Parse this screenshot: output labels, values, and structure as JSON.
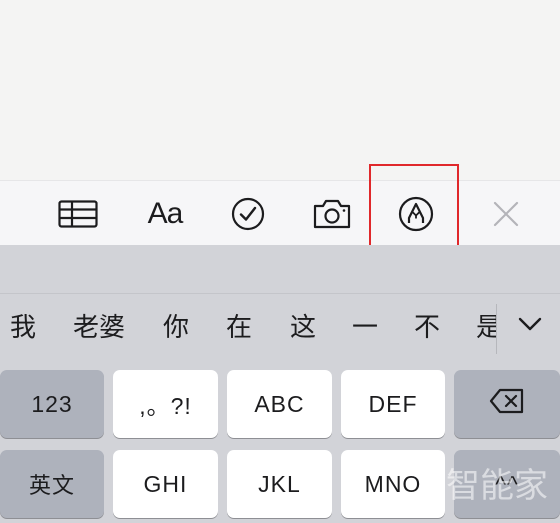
{
  "toolbar": {
    "items": [
      {
        "name": "table",
        "icon": "table-icon"
      },
      {
        "name": "format",
        "label": "Aa",
        "icon": "text-format-icon"
      },
      {
        "name": "checklist",
        "icon": "checkmark-circle-icon"
      },
      {
        "name": "camera",
        "icon": "camera-icon"
      },
      {
        "name": "markup",
        "icon": "pen-tip-circle-icon"
      },
      {
        "name": "close",
        "icon": "close-icon"
      }
    ],
    "highlight_color": "#e0282b"
  },
  "candidates": {
    "items": [
      "我",
      "老婆",
      "你",
      "在",
      "这",
      "一",
      "不",
      "是"
    ],
    "expand_icon": "chevron-down-icon"
  },
  "keyboard": {
    "row1": [
      "123",
      ",。?!",
      "ABC",
      "DEF"
    ],
    "row1_backspace_icon": "backspace-icon",
    "row2": [
      "英文",
      "GHI",
      "JKL",
      "MNO",
      "^^"
    ]
  },
  "watermark": "智能家"
}
